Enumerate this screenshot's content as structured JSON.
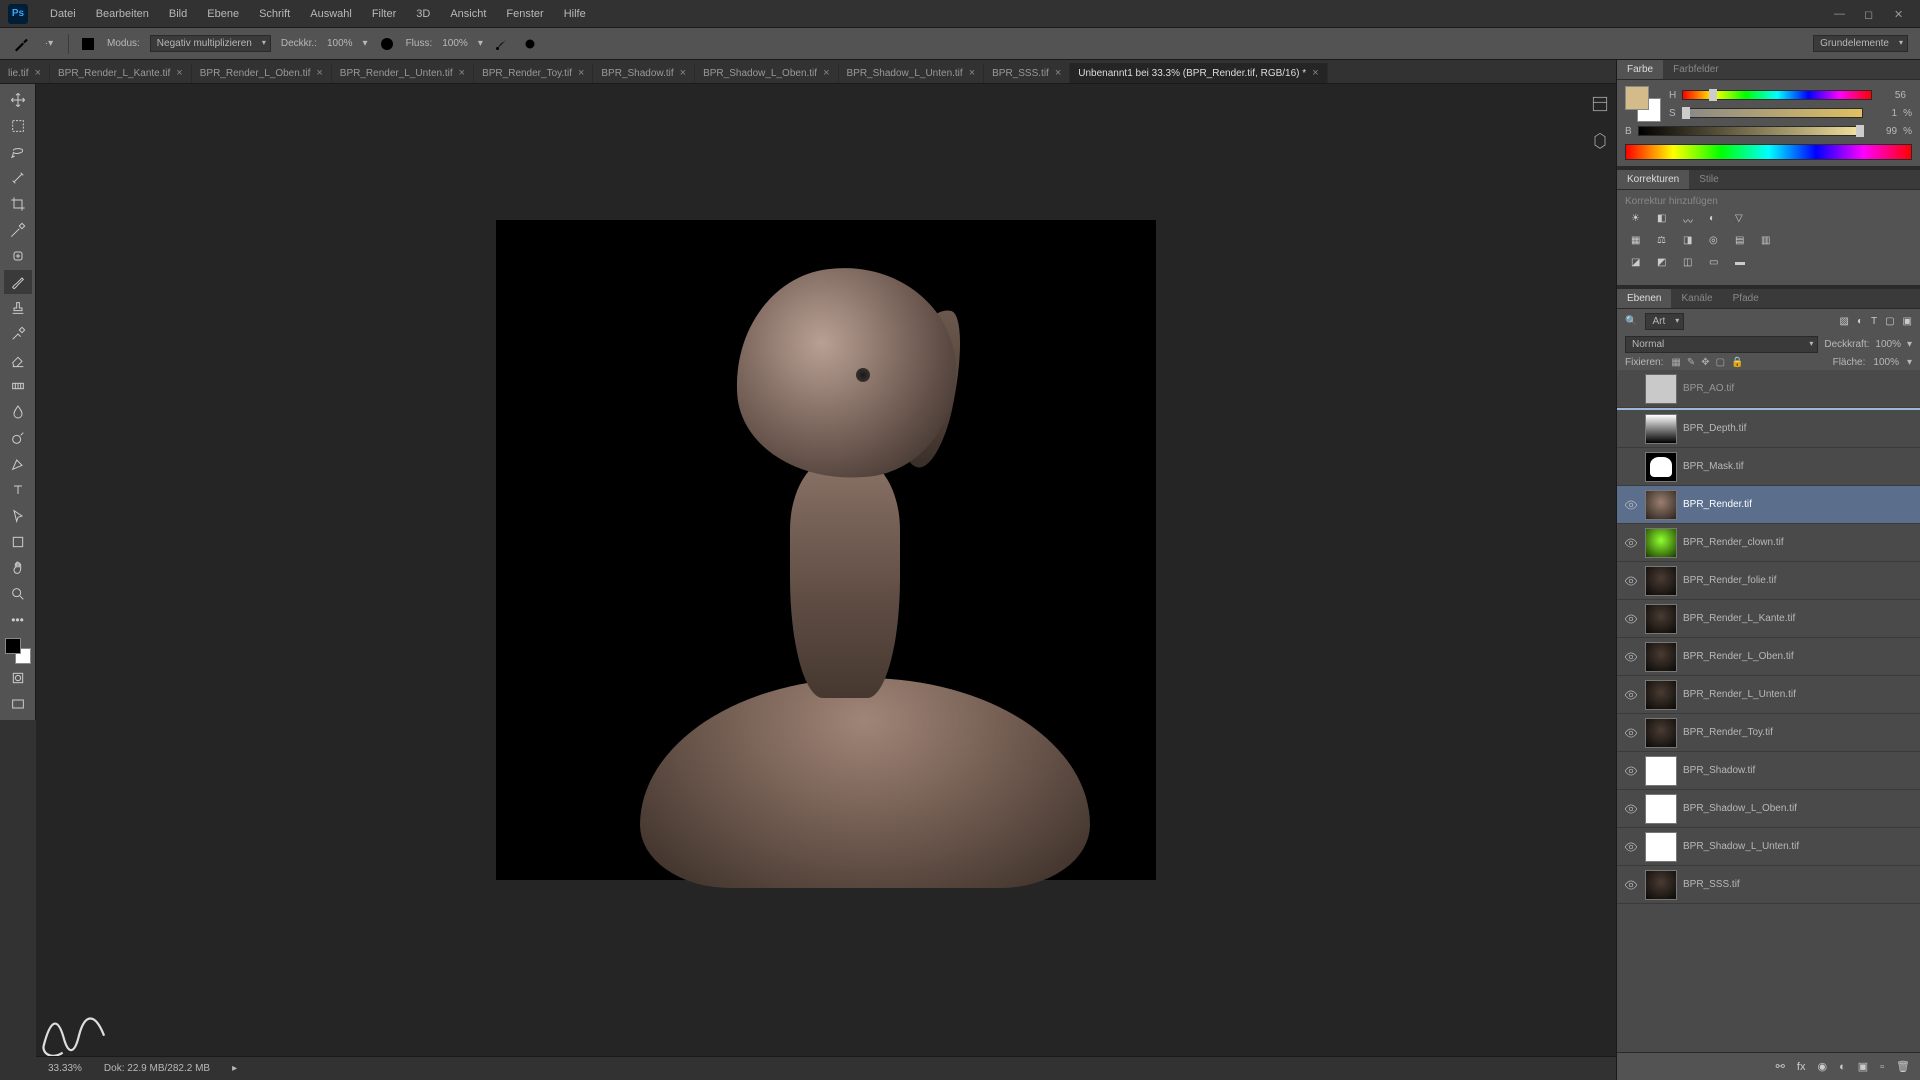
{
  "menu": [
    "Datei",
    "Bearbeiten",
    "Bild",
    "Ebene",
    "Schrift",
    "Auswahl",
    "Filter",
    "3D",
    "Ansicht",
    "Fenster",
    "Hilfe"
  ],
  "options": {
    "mode_label": "Modus:",
    "mode_value": "Negativ multiplizieren",
    "opacity_label": "Deckkr.:",
    "opacity_value": "100%",
    "flow_label": "Fluss:",
    "flow_value": "100%",
    "workspace": "Grundelemente"
  },
  "tabs": [
    {
      "label": "lie.tif",
      "active": false
    },
    {
      "label": "BPR_Render_L_Kante.tif",
      "active": false
    },
    {
      "label": "BPR_Render_L_Oben.tif",
      "active": false
    },
    {
      "label": "BPR_Render_L_Unten.tif",
      "active": false
    },
    {
      "label": "BPR_Render_Toy.tif",
      "active": false
    },
    {
      "label": "BPR_Shadow.tif",
      "active": false
    },
    {
      "label": "BPR_Shadow_L_Oben.tif",
      "active": false
    },
    {
      "label": "BPR_Shadow_L_Unten.tif",
      "active": false
    },
    {
      "label": "BPR_SSS.tif",
      "active": false
    },
    {
      "label": "Unbenannt1 bei 33.3% (BPR_Render.tif, RGB/16) *",
      "active": true
    }
  ],
  "status": {
    "zoom": "33.33%",
    "doc": "Dok: 22.9 MB/282.2 MB"
  },
  "color_panel": {
    "tabs": [
      "Farbe",
      "Farbfelder"
    ],
    "sliders": [
      {
        "ch": "H",
        "val": "56",
        "pct": "",
        "pos": 16
      },
      {
        "ch": "S",
        "val": "1",
        "pct": "%",
        "pos": 2
      },
      {
        "ch": "B",
        "val": "99",
        "pct": "%",
        "pos": 99
      }
    ]
  },
  "adjust_panel": {
    "tabs": [
      "Korrekturen",
      "Stile"
    ],
    "hint": "Korrektur hinzufügen"
  },
  "layers_panel": {
    "tabs": [
      "Ebenen",
      "Kanäle",
      "Pfade"
    ],
    "kind": "Art",
    "blend_mode": "Normal",
    "opacity_label": "Deckkraft:",
    "opacity_value": "100%",
    "lock_label": "Fixieren:",
    "fill_label": "Fläche:",
    "fill_value": "100%"
  },
  "layers": [
    {
      "name": "BPR_AO.tif",
      "visible": false,
      "thumb": "white",
      "selected": false,
      "dragging": true
    },
    {
      "name": "BPR_Depth.tif",
      "visible": false,
      "thumb": "depth",
      "selected": false
    },
    {
      "name": "BPR_Mask.tif",
      "visible": false,
      "thumb": "mask",
      "selected": false
    },
    {
      "name": "BPR_Render.tif",
      "visible": true,
      "thumb": "render",
      "selected": true
    },
    {
      "name": "BPR_Render_clown.tif",
      "visible": true,
      "thumb": "clown",
      "selected": false
    },
    {
      "name": "BPR_Render_folie.tif",
      "visible": true,
      "thumb": "dark",
      "selected": false
    },
    {
      "name": "BPR_Render_L_Kante.tif",
      "visible": true,
      "thumb": "dark",
      "selected": false
    },
    {
      "name": "BPR_Render_L_Oben.tif",
      "visible": true,
      "thumb": "dark",
      "selected": false
    },
    {
      "name": "BPR_Render_L_Unten.tif",
      "visible": true,
      "thumb": "dark",
      "selected": false
    },
    {
      "name": "BPR_Render_Toy.tif",
      "visible": true,
      "thumb": "dark",
      "selected": false
    },
    {
      "name": "BPR_Shadow.tif",
      "visible": true,
      "thumb": "white",
      "selected": false
    },
    {
      "name": "BPR_Shadow_L_Oben.tif",
      "visible": true,
      "thumb": "white",
      "selected": false
    },
    {
      "name": "BPR_Shadow_L_Unten.tif",
      "visible": true,
      "thumb": "white",
      "selected": false
    },
    {
      "name": "BPR_SSS.tif",
      "visible": true,
      "thumb": "dark",
      "selected": false
    }
  ]
}
